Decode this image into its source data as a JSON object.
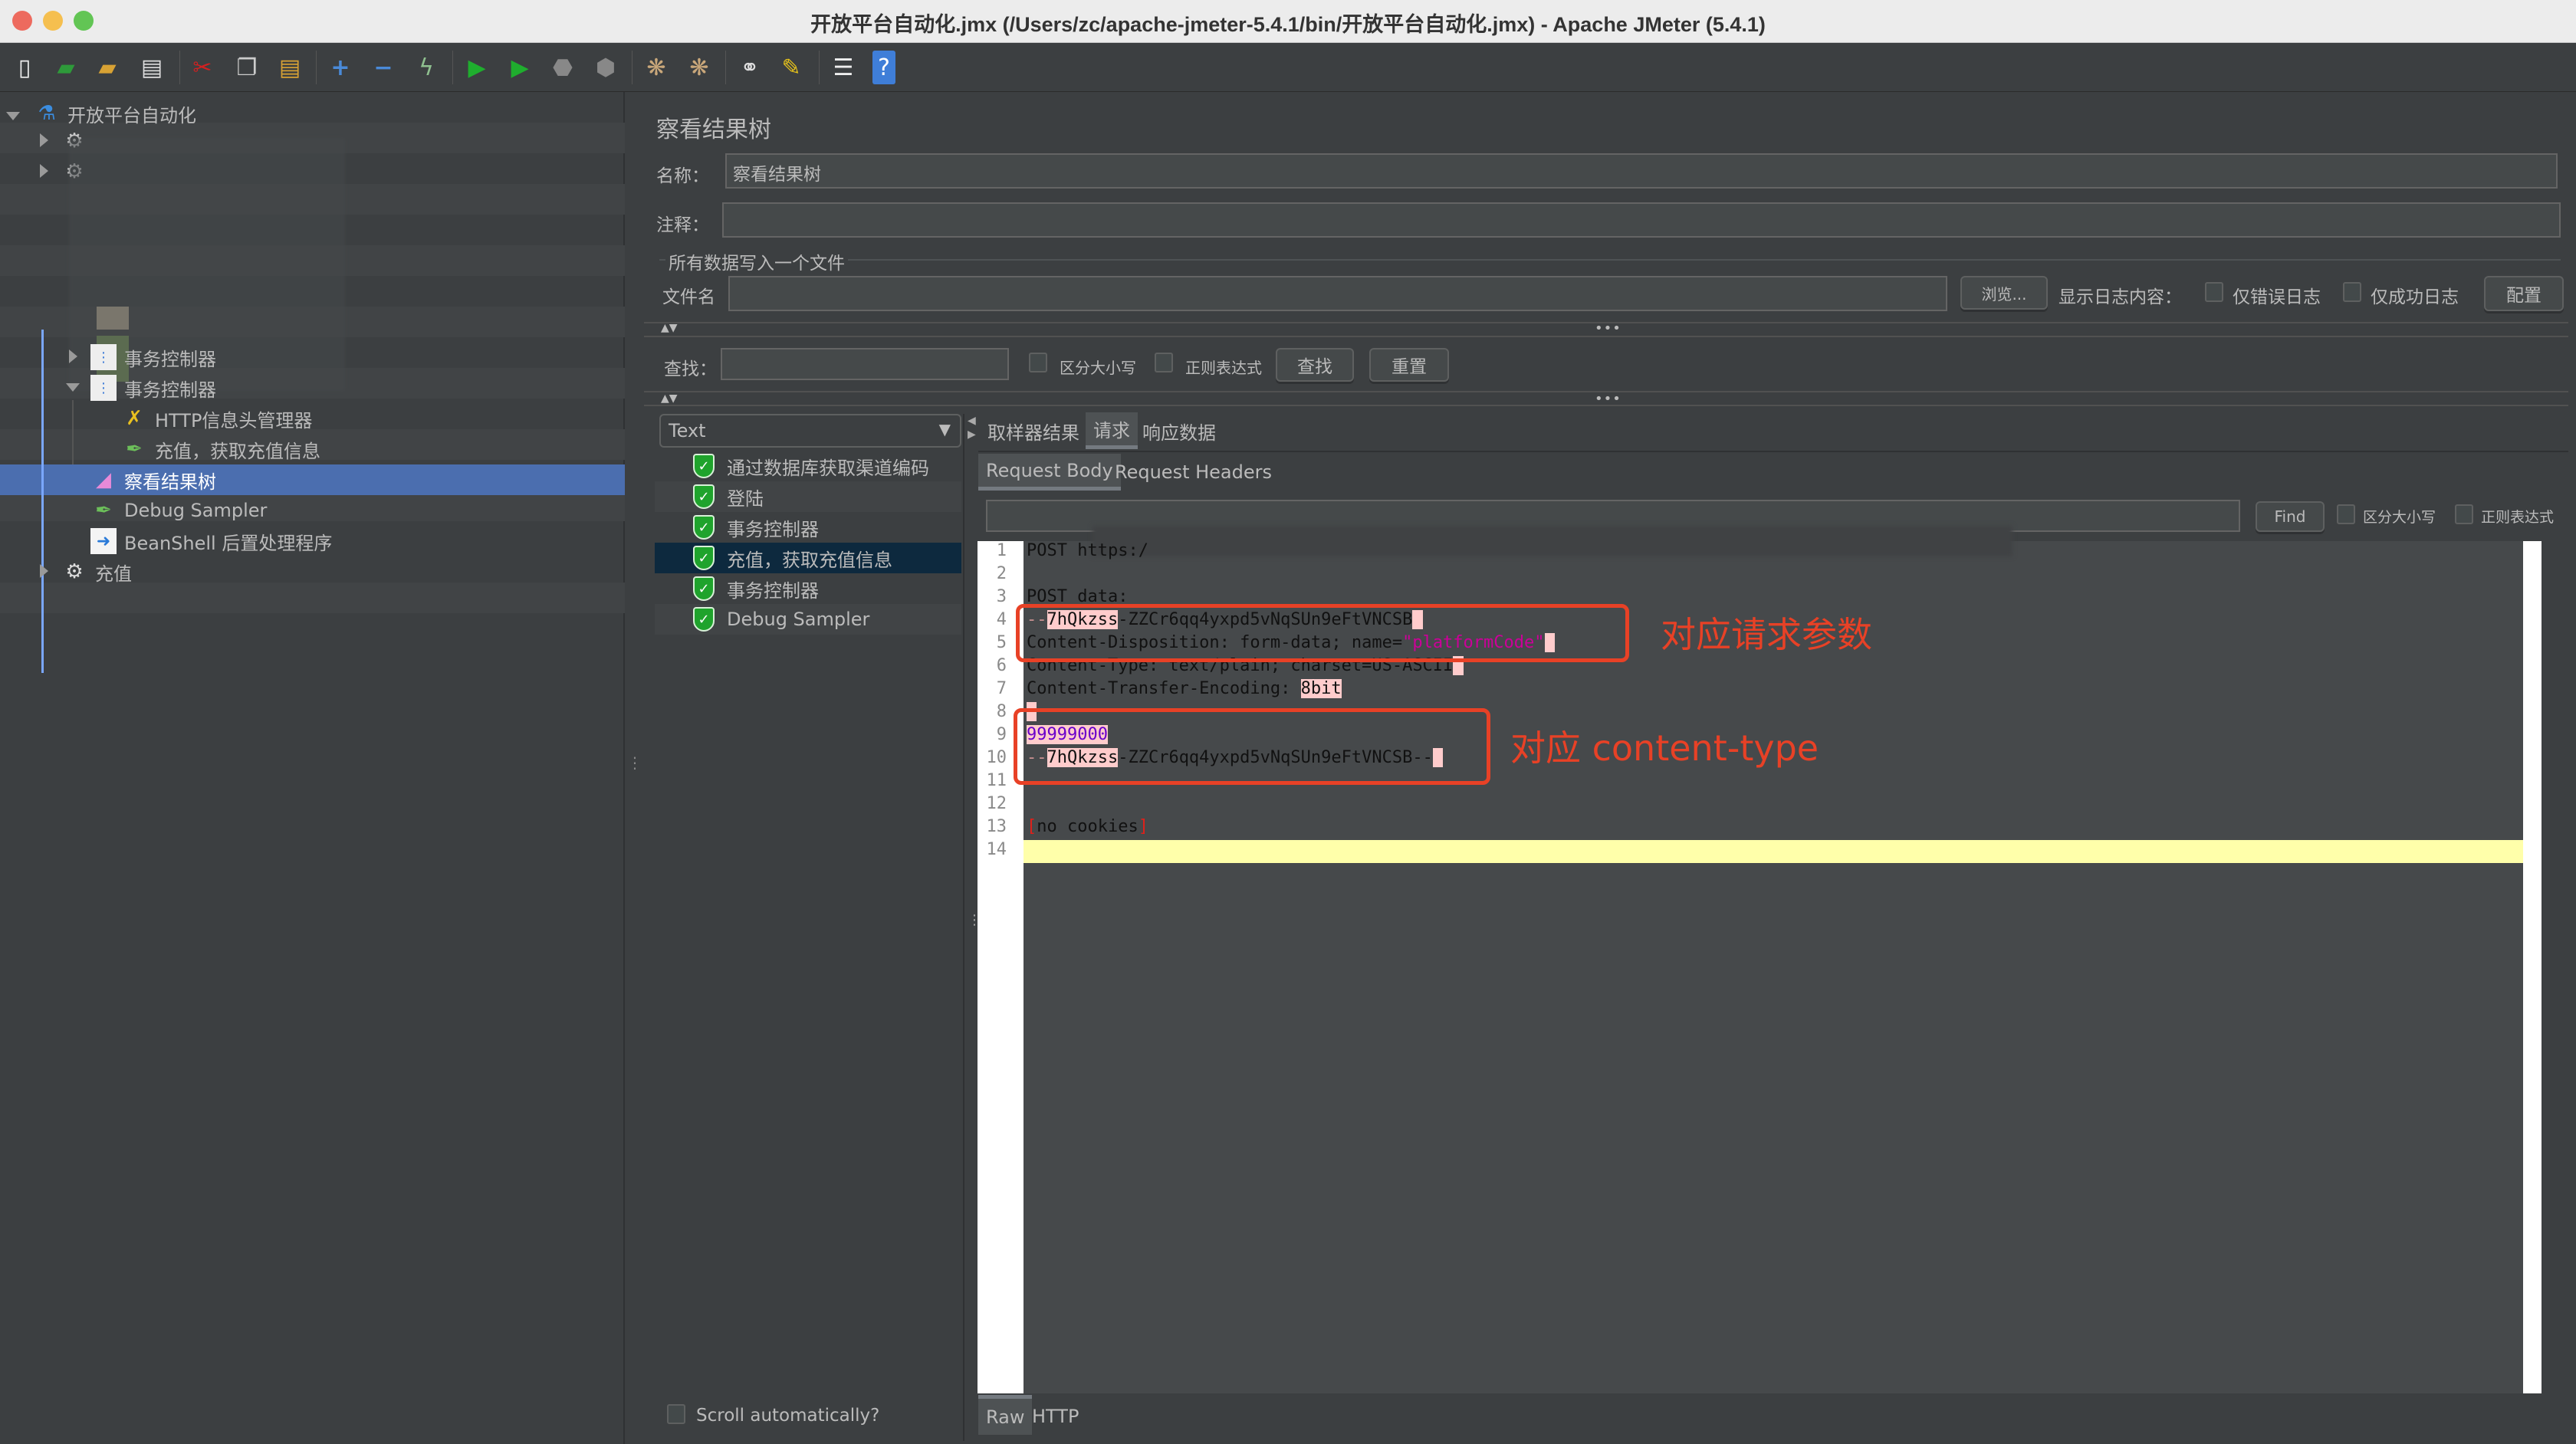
{
  "window": {
    "title": "开放平台自动化.jmx (/Users/zc/apache-jmeter-5.4.1/bin/开放平台自动化.jmx) - Apache JMeter (5.4.1)",
    "traffic_lights": {
      "close": "#ed6a5e",
      "minimize": "#f5bf4f",
      "zoom": "#62c554"
    }
  },
  "toolbar": {
    "buttons": [
      {
        "name": "new-icon",
        "glyph": "📄"
      },
      {
        "name": "templates-icon",
        "glyph": "📗"
      },
      {
        "name": "open-icon",
        "glyph": "📂"
      },
      {
        "name": "save-icon",
        "glyph": "💾"
      },
      {
        "name": "cut-icon",
        "glyph": "✂"
      },
      {
        "name": "copy-icon",
        "glyph": "📋"
      },
      {
        "name": "paste-icon",
        "glyph": "📋"
      },
      {
        "name": "expand-icon",
        "glyph": "+"
      },
      {
        "name": "collapse-icon",
        "glyph": "−"
      },
      {
        "name": "toggle-icon",
        "glyph": "⚡"
      },
      {
        "name": "start-icon",
        "glyph": "▶"
      },
      {
        "name": "start-no-pause-icon",
        "glyph": "▶"
      },
      {
        "name": "stop-icon",
        "glyph": "⬣"
      },
      {
        "name": "shutdown-icon",
        "glyph": "✖"
      },
      {
        "name": "clear-icon",
        "glyph": "⚙"
      },
      {
        "name": "clear-all-icon",
        "glyph": "⚙"
      },
      {
        "name": "search-icon",
        "glyph": "🔭"
      },
      {
        "name": "reset-search-icon",
        "glyph": "🧹"
      },
      {
        "name": "function-helper-icon",
        "glyph": "☰"
      },
      {
        "name": "help-icon",
        "glyph": "?"
      }
    ]
  },
  "tree": {
    "root": "开放平台自动化",
    "items": [
      {
        "label": "事务控制器",
        "collapsed": true
      },
      {
        "label": "事务控制器",
        "expanded": true
      },
      {
        "label": "HTTP信息头管理器"
      },
      {
        "label": "充值，获取充值信息"
      },
      {
        "label": "察看结果树",
        "selected": true
      },
      {
        "label": "Debug Sampler"
      },
      {
        "label": "BeanShell 后置处理程序"
      },
      {
        "label": "充值",
        "collapsed": true
      }
    ]
  },
  "panel": {
    "title": "察看结果树",
    "name_label": "名称：",
    "name_value": "察看结果树",
    "comment_label": "注释：",
    "comment_value": "",
    "file_group_label": "所有数据写入一个文件",
    "filename_label": "文件名",
    "filename_value": "",
    "browse_button": "浏览...",
    "log_content_label": "显示日志内容：",
    "errors_only_label": "仅错误日志",
    "success_only_label": "仅成功日志",
    "configure_button": "配置",
    "search_label": "查找：",
    "search_value": "",
    "case_sensitive_label": "区分大小写",
    "regex_label": "正则表达式",
    "search_button": "查找",
    "reset_button": "重置"
  },
  "results": {
    "renderer": "Text",
    "items": [
      {
        "label": "通过数据库获取渠道编码",
        "status": "success"
      },
      {
        "label": "登陆",
        "status": "success"
      },
      {
        "label": "事务控制器",
        "status": "success"
      },
      {
        "label": "充值，获取充值信息",
        "status": "success",
        "selected": true
      },
      {
        "label": "事务控制器",
        "status": "success"
      },
      {
        "label": "Debug Sampler",
        "status": "success"
      }
    ],
    "scroll_auto_label": "Scroll automatically?"
  },
  "detail": {
    "tabs": [
      {
        "label": "取样器结果"
      },
      {
        "label": "请求",
        "active": true
      },
      {
        "label": "响应数据"
      }
    ],
    "subtabs": [
      {
        "label": "Request Body",
        "active": true
      },
      {
        "label": "Request Headers"
      }
    ],
    "find_button": "Find",
    "find_value": "",
    "case_sensitive_label": "区分大小写",
    "regex_label": "正则表达式",
    "bottom_tabs": [
      {
        "label": "Raw",
        "active": true
      },
      {
        "label": "HTTP"
      }
    ],
    "lines": [
      {
        "n": "1",
        "text": "POST https:/"
      },
      {
        "n": "2",
        "text": ""
      },
      {
        "n": "3",
        "text": "POST data:"
      },
      {
        "n": "4",
        "prefix": "--",
        "token": "7hQkzss",
        "rest": "-ZZCr6qq4yxpd5vNqSUn9eFtVNCSB"
      },
      {
        "n": "5",
        "text": "Content-Disposition: form-data; name=",
        "quoted": "\"platformCode\""
      },
      {
        "n": "6",
        "text": "Content-Type: text/plain; charset=US-ASCII"
      },
      {
        "n": "7",
        "text": "Content-Transfer-Encoding: ",
        "token": "8bit"
      },
      {
        "n": "8",
        "text": ""
      },
      {
        "n": "9",
        "value": "99999000"
      },
      {
        "n": "10",
        "prefix": "--",
        "token": "7hQkzss",
        "rest": "-ZZCr6qq4yxpd5vNqSUn9eFtVNCSB--"
      },
      {
        "n": "11",
        "text": ""
      },
      {
        "n": "12",
        "text": ""
      },
      {
        "n": "13",
        "open": "[",
        "text": "no cookies",
        "close": "]"
      },
      {
        "n": "14",
        "text": ""
      }
    ]
  },
  "annotations": [
    {
      "label": "对应请求参数",
      "color": "#e84126"
    },
    {
      "label": "对应 content-type",
      "color": "#e84126"
    }
  ]
}
